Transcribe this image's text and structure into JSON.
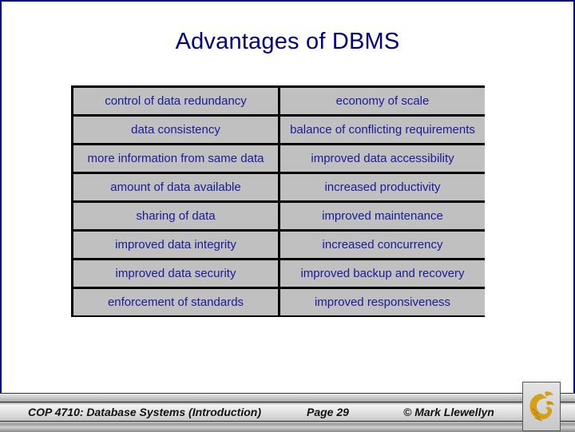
{
  "slide": {
    "title": "Advantages of DBMS"
  },
  "advantages": {
    "rows": [
      [
        "control of data redundancy",
        "economy of scale"
      ],
      [
        "data consistency",
        "balance of conflicting requirements"
      ],
      [
        "more information from same data",
        "improved data accessibility"
      ],
      [
        "amount of data available",
        "increased productivity"
      ],
      [
        "sharing of data",
        "improved maintenance"
      ],
      [
        "improved data integrity",
        "increased concurrency"
      ],
      [
        "improved data security",
        "improved backup and recovery"
      ],
      [
        "enforcement of standards",
        "improved responsiveness"
      ]
    ]
  },
  "footer": {
    "course": "COP 4710: Database Systems  (Introduction)",
    "page": "Page 29",
    "author": "© Mark Llewellyn",
    "logo_icon": "pegasus-logo-icon"
  },
  "colors": {
    "title": "#000080",
    "cell_text": "#1a1a99",
    "cell_bg": "#c0c0c0",
    "logo_gold": "#d4a017"
  }
}
